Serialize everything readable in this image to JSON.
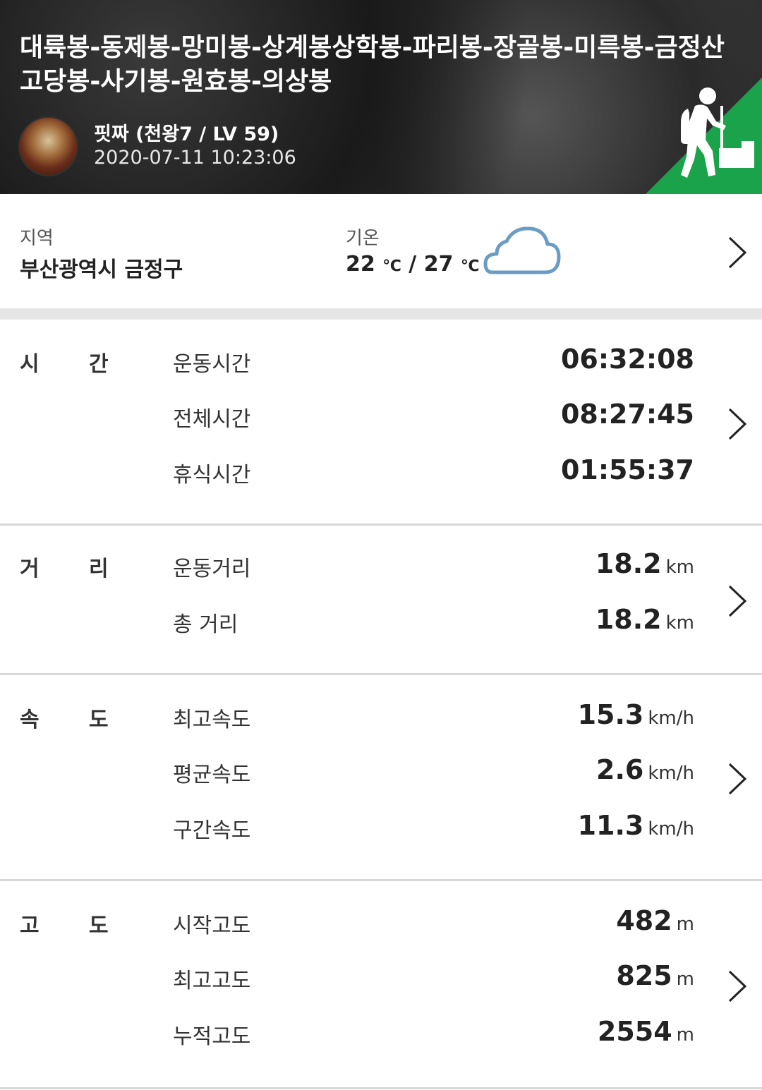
{
  "header": {
    "title": "대륙봉-동제봉-망미봉-상계봉상학봉-파리봉-장골봉-미륵봉-금정산고당봉-사기봉-원효봉-의상봉",
    "user_name": "핏짜 (천왕7 / LV 59)",
    "date": "2020-07-11 10:23:06",
    "badge_icon": "hiker-icon",
    "badge_color": "#1aa34a"
  },
  "location": {
    "region_label": "지역",
    "region_value": "부산광역시 금정구",
    "temp_label": "기온",
    "temp_low": "22",
    "temp_high": "27",
    "temp_unit": "℃",
    "temp_sep": " / ",
    "weather_icon": "cloud-icon",
    "weather_color": "#6a9cc4"
  },
  "sections": {
    "time": {
      "h1": "시",
      "h2": "간",
      "rows": [
        {
          "label": "운동시간",
          "value": "06:32:08",
          "unit": ""
        },
        {
          "label": "전체시간",
          "value": "08:27:45",
          "unit": ""
        },
        {
          "label": "휴식시간",
          "value": "01:55:37",
          "unit": ""
        }
      ]
    },
    "distance": {
      "h1": "거",
      "h2": "리",
      "rows": [
        {
          "label": "운동거리",
          "value": "18.2",
          "unit": "km"
        },
        {
          "label": "총 거리",
          "value": "18.2",
          "unit": "km"
        }
      ]
    },
    "speed": {
      "h1": "속",
      "h2": "도",
      "rows": [
        {
          "label": "최고속도",
          "value": "15.3",
          "unit": "km/h"
        },
        {
          "label": "평균속도",
          "value": "2.6",
          "unit": "km/h"
        },
        {
          "label": "구간속도",
          "value": "11.3",
          "unit": "km/h"
        }
      ]
    },
    "altitude": {
      "h1": "고",
      "h2": "도",
      "rows": [
        {
          "label": "시작고도",
          "value": "482",
          "unit": "m"
        },
        {
          "label": "최고고도",
          "value": "825",
          "unit": "m"
        },
        {
          "label": "누적고도",
          "value": "2554",
          "unit": "m"
        }
      ]
    }
  }
}
